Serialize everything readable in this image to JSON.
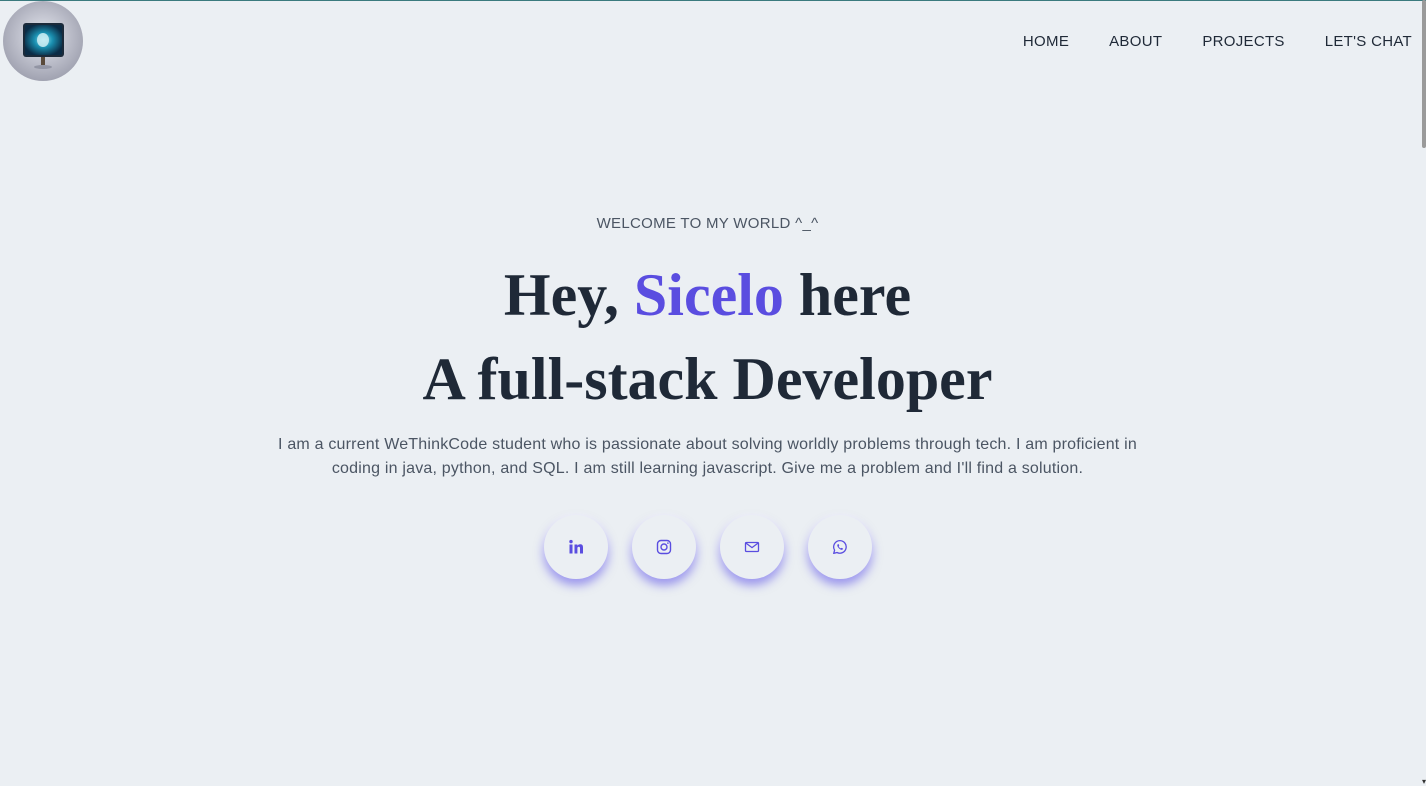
{
  "header": {
    "nav": [
      "HOME",
      "ABOUT",
      "PROJECTS",
      "LET'S CHAT"
    ]
  },
  "hero": {
    "welcome": "WELCOME TO MY WORLD ^_^",
    "greeting_prefix": "Hey, ",
    "name": "Sicelo",
    "greeting_suffix": " here",
    "subtitle": "A full-stack Developer",
    "bio": "I am a current WeThinkCode student who is passionate about solving worldly problems through tech. I am proficient in coding in java, python, and SQL. I am still learning javascript. Give me a problem and I'll find a solution."
  },
  "socials": [
    {
      "icon": "linkedin-icon"
    },
    {
      "icon": "instagram-icon"
    },
    {
      "icon": "mail-icon"
    },
    {
      "icon": "whatsapp-icon"
    }
  ],
  "colors": {
    "background": "#ebeff3",
    "accent": "#5a4de0",
    "heading": "#1f2937",
    "text": "#4b5563"
  }
}
